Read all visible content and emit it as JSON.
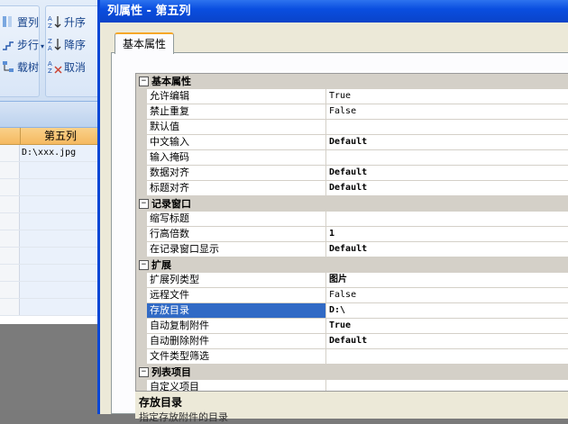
{
  "ribbon": {
    "group1": [
      {
        "label": "置列",
        "icon": "column-icon"
      },
      {
        "label": "步行",
        "icon": "step-icon",
        "dropdown": "▾"
      },
      {
        "label": "载树",
        "icon": "tree-icon"
      }
    ],
    "group2": [
      {
        "label": "升序",
        "icon": "sort-asc-icon"
      },
      {
        "label": "降序",
        "icon": "sort-desc-icon"
      },
      {
        "label": "取消",
        "icon": "cancel-sort-icon"
      }
    ]
  },
  "grid": {
    "header": "第五列",
    "rows": [
      "D:\\xxx.jpg",
      "",
      "",
      "",
      "",
      "",
      "",
      "",
      "",
      ""
    ]
  },
  "dialog": {
    "title": "列属性 - 第五列",
    "tab": "基本属性",
    "categories": [
      {
        "label": "基本属性",
        "toggle": "⊟",
        "items": [
          {
            "name": "允许编辑",
            "value": "True",
            "bold": false
          },
          {
            "name": "禁止重复",
            "value": "False",
            "bold": false
          },
          {
            "name": "默认值",
            "value": "",
            "bold": false
          },
          {
            "name": "中文输入",
            "value": "Default",
            "bold": true
          },
          {
            "name": "输入掩码",
            "value": "",
            "bold": false
          },
          {
            "name": "数据对齐",
            "value": "Default",
            "bold": true
          },
          {
            "name": "标题对齐",
            "value": "Default",
            "bold": true
          }
        ]
      },
      {
        "label": "记录窗口",
        "toggle": "⊟",
        "items": [
          {
            "name": "缩写标题",
            "value": "",
            "bold": false
          },
          {
            "name": "行高倍数",
            "value": "1",
            "bold": true
          },
          {
            "name": "在记录窗口显示",
            "value": "Default",
            "bold": true
          }
        ]
      },
      {
        "label": "扩展",
        "toggle": "⊟",
        "items": [
          {
            "name": "扩展列类型",
            "value": "图片",
            "bold": true
          },
          {
            "name": "远程文件",
            "value": "False",
            "bold": false
          },
          {
            "name": "存放目录",
            "value": "D:\\",
            "bold": true,
            "selected": true,
            "button": "..."
          },
          {
            "name": "自动复制附件",
            "value": "True",
            "bold": true
          },
          {
            "name": "自动删除附件",
            "value": "Default",
            "bold": true
          },
          {
            "name": "文件类型筛选",
            "value": "",
            "bold": false
          }
        ]
      },
      {
        "label": "列表项目",
        "toggle": "⊟",
        "items": [
          {
            "name": "自定义项目",
            "value": "",
            "bold": false
          }
        ]
      }
    ],
    "description": {
      "title": "存放目录",
      "text": "指定存放附件的目录"
    }
  }
}
